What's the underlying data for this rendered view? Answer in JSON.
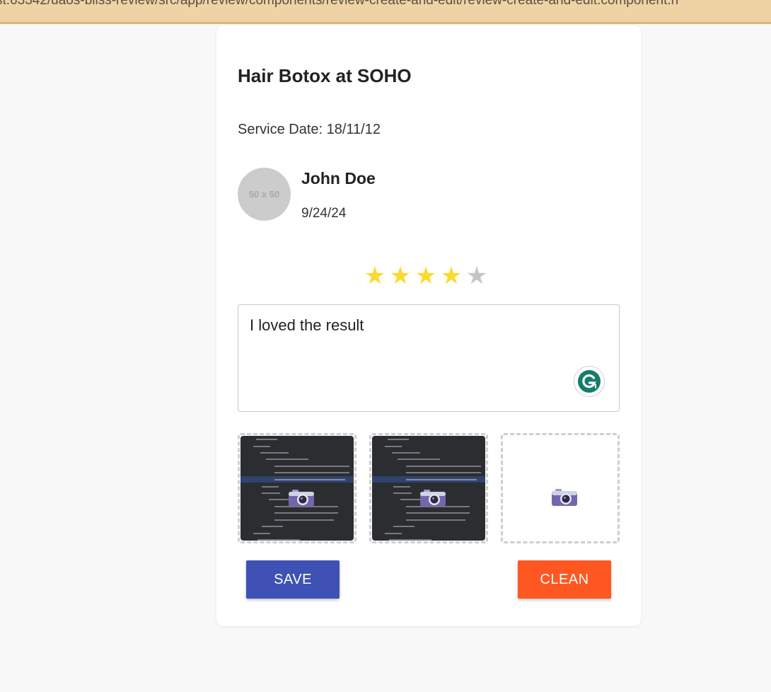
{
  "browser": {
    "url_fragment": "st:63342/daos-bliss-review/src/app/review/components/review-create-and-edit/review-create-and-edit.component.h"
  },
  "review": {
    "title": "Hair Botox at SOHO",
    "service_date": "Service Date: 18/11/12",
    "user": {
      "avatar_placeholder": "50 x 50",
      "name": "John Doe",
      "date": "9/24/24"
    },
    "rating": {
      "value": 4,
      "max": 5,
      "star_glyph": "★"
    },
    "comment": "I loved the result",
    "photos": [
      {
        "state": "filled",
        "icon": "camera-icon"
      },
      {
        "state": "filled",
        "icon": "camera-icon"
      },
      {
        "state": "empty",
        "icon": "camera-icon"
      }
    ]
  },
  "actions": {
    "save_label": "SAVE",
    "clean_label": "CLEAN"
  },
  "colors": {
    "star_on": "#fcd92f",
    "star_off": "#c5c5c5",
    "save": "#3f51b5",
    "clean": "#ff5722",
    "grammarly": "#15c39a"
  }
}
